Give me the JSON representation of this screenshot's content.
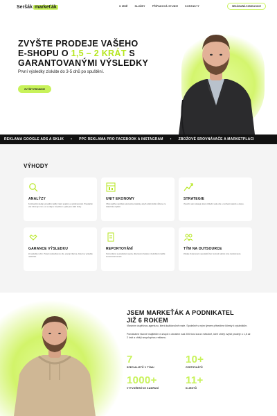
{
  "nav": {
    "logo_a": "Seršák",
    "logo_b": "markeťák",
    "items": [
      "O MNĚ",
      "SLUŽBY",
      "PŘÍPADOVÁ STUDIE",
      "KONTAKTY"
    ],
    "cta": "NEZÁVAZNÁ KONZULTACE"
  },
  "hero": {
    "title_1": "ZVYŠTE PRODEJE VAŠEHO",
    "title_2a": "E-SHOPU O ",
    "title_2b": "1,5 – 2 KRÁT",
    "title_2c": " S",
    "title_3": "GARANTOVANÝMI VÝSLEDKY",
    "subtitle": "První výsledky získáte do 3-5 dnů po spuštění.",
    "cta": "ZVÝŠIT PRODEJE"
  },
  "ticker": [
    "REKLAMA GOOGLE ADS A SKLIK",
    "PPC REKLAMA PRO FACEBOOK A INSTAGRAM",
    "ZBOŽOVÉ SROVNÁVAČE A MARKETPLACI"
  ],
  "benefits": {
    "title": "VÝHODY",
    "cards": [
      {
        "icon": "search-icon",
        "title": "ANALÝZY",
        "desc": "Kontinuálně sleduji, provádím každý měsíc analýzy a vyhodnocování. Pravidelně vás informuji o tom, co se děje s rozpočtem a jaké jsou další kroky."
      },
      {
        "icon": "unit-economy-icon",
        "title": "UNIT EKONOMY",
        "desc": "Vždy nejdříve spočítám ekonomiku zakázky, abych věděl, kolik můžeme za zákazníka zaplatit."
      },
      {
        "icon": "strategy-icon",
        "title": "STRATEGIE",
        "desc": "Vytvořím vám strategii, která zohlední vaše cíle a možnosti vašeho e-shopu."
      },
      {
        "icon": "guarantee-icon",
        "title": "GARANCE VÝSLEDKU",
        "desc": "Za výsledky ručím. Pokud nedosáhneme cíle, pracuji zdarma, dokud se výsledek nedostaví."
      },
      {
        "icon": "report-icon",
        "title": "REPORTOVÁNÍ",
        "desc": "Srozumitelné a pravidelné reporty, díky kterým budete mít přehled o každé investované koruně."
      },
      {
        "icon": "team-icon",
        "title": "TÝM NA OUTSOURCE",
        "desc": "Získáte zkušený tým specialistů bez nutnosti nabírat nové zaměstnance."
      }
    ]
  },
  "about": {
    "title_1": "JSEM MARKEŤÁK A PODNIKATEL",
    "title_2": "JIŽ 6 ROKEM",
    "p1": "Vlastním úspěšnou agenturu, která každoročně roste. Společně s mým týmem přivedíme klienty k výsledkům.",
    "p2": "Pomaháme hlavně majitelům e-shopů s obratem nad 200 tisíc korun měsíčně, kteří chtějí zvýšit prodeje o 1,5 až 2 krát a chtějí smysluplnou reklamu.",
    "stats": [
      {
        "value": "7",
        "label": "SPECIALISTŮ V TÝMU"
      },
      {
        "value": "10+",
        "label": "CERTIFIKÁTŮ"
      },
      {
        "value": "1000+",
        "label": "VYTVOŘENÝCH KAMPANÍ"
      },
      {
        "value": "11+",
        "label": "KLIENTŮ"
      }
    ]
  },
  "colors": {
    "accent": "#c8f25a",
    "dark": "#111111",
    "bg_light": "#f4f4f4"
  }
}
